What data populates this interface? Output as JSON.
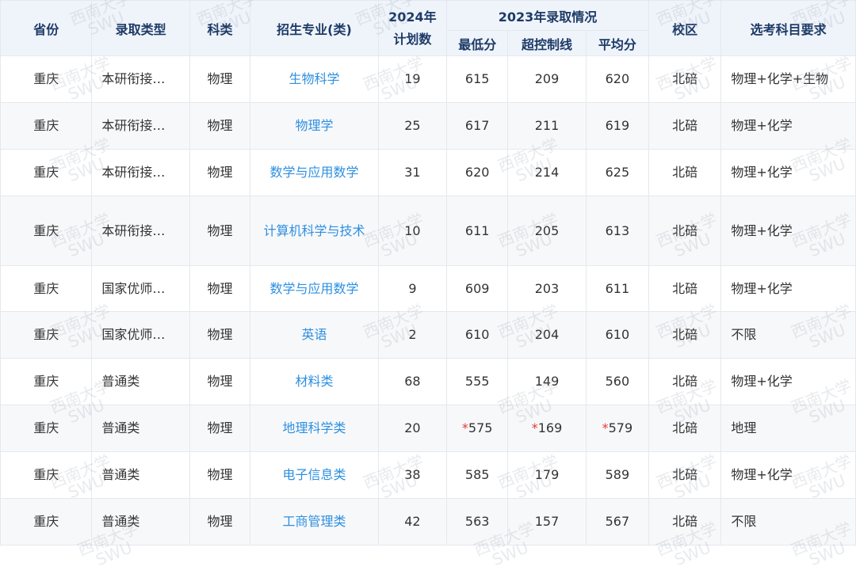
{
  "header": {
    "province": "省份",
    "admission_type": "录取类型",
    "subject_type": "科类",
    "major": "招生专业(类)",
    "plan_2024": "2024年计划数",
    "group_2023": "2023年录取情况",
    "min_score": "最低分",
    "over_control": "超控制线",
    "avg_score": "平均分",
    "campus": "校区",
    "requirements": "选考科目要求"
  },
  "rows": [
    {
      "province": "重庆",
      "type": "本研衔接…",
      "subject": "物理",
      "major": "生物科学",
      "plan": "19",
      "min": "615",
      "over": "209",
      "avg": "620",
      "campus": "北碚",
      "req": "物理+化学+生物"
    },
    {
      "province": "重庆",
      "type": "本研衔接…",
      "subject": "物理",
      "major": "物理学",
      "plan": "25",
      "min": "617",
      "over": "211",
      "avg": "619",
      "campus": "北碚",
      "req": "物理+化学"
    },
    {
      "province": "重庆",
      "type": "本研衔接…",
      "subject": "物理",
      "major": "数学与应用数学",
      "plan": "31",
      "min": "620",
      "over": "214",
      "avg": "625",
      "campus": "北碚",
      "req": "物理+化学"
    },
    {
      "province": "重庆",
      "type": "本研衔接…",
      "subject": "物理",
      "major": "计算机科学与技术",
      "plan": "10",
      "min": "611",
      "over": "205",
      "avg": "613",
      "campus": "北碚",
      "req": "物理+化学"
    },
    {
      "province": "重庆",
      "type": "国家优师…",
      "subject": "物理",
      "major": "数学与应用数学",
      "plan": "9",
      "min": "609",
      "over": "203",
      "avg": "611",
      "campus": "北碚",
      "req": "物理+化学"
    },
    {
      "province": "重庆",
      "type": "国家优师…",
      "subject": "物理",
      "major": "英语",
      "plan": "2",
      "min": "610",
      "over": "204",
      "avg": "610",
      "campus": "北碚",
      "req": "不限"
    },
    {
      "province": "重庆",
      "type": "普通类",
      "subject": "物理",
      "major": "材料类",
      "plan": "68",
      "min": "555",
      "over": "149",
      "avg": "560",
      "campus": "北碚",
      "req": "物理+化学"
    },
    {
      "province": "重庆",
      "type": "普通类",
      "subject": "物理",
      "major": "地理科学类",
      "plan": "20",
      "min": "575",
      "over": "169",
      "avg": "579",
      "campus": "北碚",
      "req": "地理",
      "starred": "*"
    },
    {
      "province": "重庆",
      "type": "普通类",
      "subject": "物理",
      "major": "电子信息类",
      "plan": "38",
      "min": "585",
      "over": "179",
      "avg": "589",
      "campus": "北碚",
      "req": "物理+化学"
    },
    {
      "province": "重庆",
      "type": "普通类",
      "subject": "物理",
      "major": "工商管理类",
      "plan": "42",
      "min": "563",
      "over": "157",
      "avg": "567",
      "campus": "北碚",
      "req": "不限"
    }
  ],
  "watermark": {
    "line1": "西南大学",
    "line2": "SWU"
  },
  "colors": {
    "header_bg": "#eff4fb",
    "header_text": "#1d3a66",
    "link": "#2e8fe0",
    "star": "#e8382f",
    "stripe": "#f7f8fa"
  }
}
